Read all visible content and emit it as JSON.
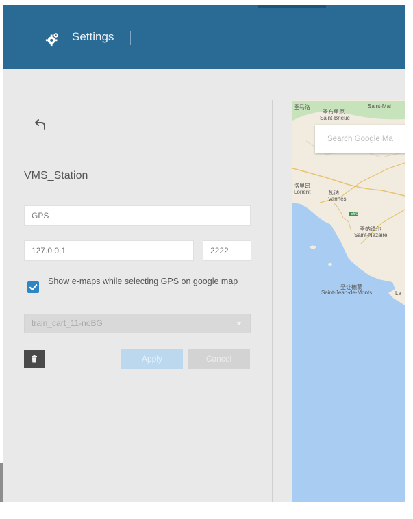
{
  "header": {
    "title": "Settings",
    "settings_icon": "gear-icon",
    "color": "#2a6b96"
  },
  "form": {
    "back_icon": "back-arrow-icon",
    "station_name": "VMS_Station",
    "gps_value": "GPS",
    "ip_value": "127.0.0.1",
    "port_value": "2222",
    "show_emaps_checked": true,
    "show_emaps_label": "Show e-maps while selecting GPS on google map",
    "map_select_value": "train_cart_11-noBG",
    "delete_icon": "trash-icon",
    "apply_label": "Apply",
    "cancel_label": "Cancel"
  },
  "map": {
    "search_placeholder": "Search Google Ma",
    "labels": {
      "saint_malo_top": "Saint-Mal",
      "saint_malo_cn": "圣马洛",
      "saint_brieuc_cn": "圣布里厄",
      "saint_brieuc": "Saint-Brieuc",
      "lorient_cn": "洛里昂",
      "lorient": "Lorient",
      "vannes_cn": "瓦讷",
      "vannes": "Vannes",
      "saint_nazaire_cn": "圣纳泽尔",
      "saint_nazaire": "Saint-Nazaire",
      "saint_jean_cn": "圣让德蒙",
      "saint_jean": "Saint-Jean-de-Monts",
      "la": "La",
      "road_label": "E60"
    }
  }
}
